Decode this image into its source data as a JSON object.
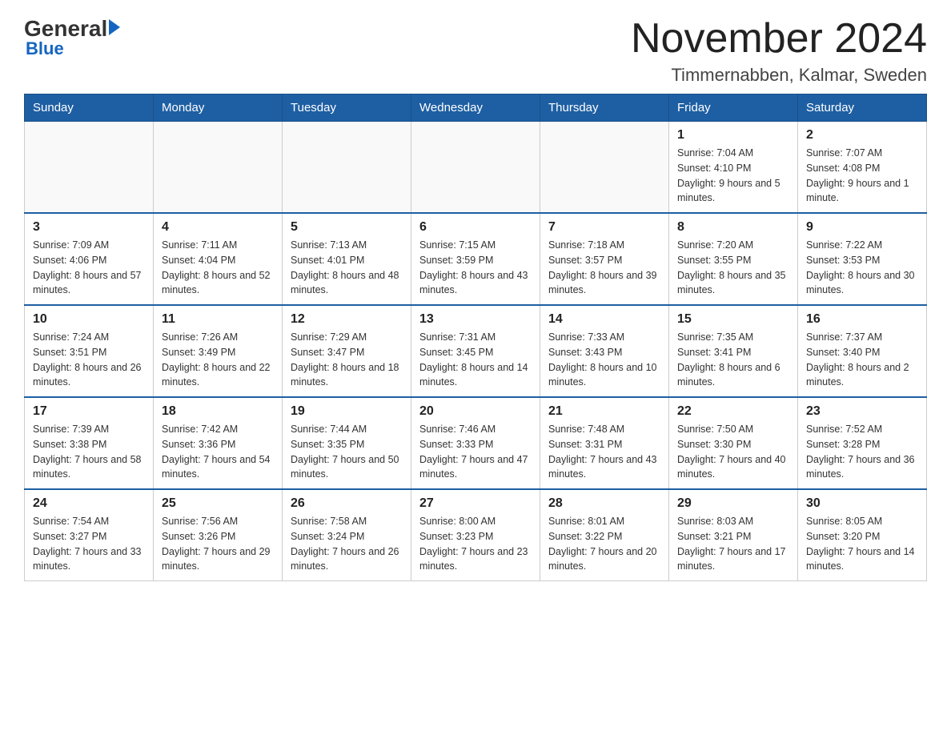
{
  "header": {
    "logo_general": "General",
    "logo_blue": "Blue",
    "month_title": "November 2024",
    "location": "Timmernabben, Kalmar, Sweden"
  },
  "days_of_week": [
    "Sunday",
    "Monday",
    "Tuesday",
    "Wednesday",
    "Thursday",
    "Friday",
    "Saturday"
  ],
  "weeks": [
    [
      {
        "day": "",
        "info": ""
      },
      {
        "day": "",
        "info": ""
      },
      {
        "day": "",
        "info": ""
      },
      {
        "day": "",
        "info": ""
      },
      {
        "day": "",
        "info": ""
      },
      {
        "day": "1",
        "info": "Sunrise: 7:04 AM\nSunset: 4:10 PM\nDaylight: 9 hours and 5 minutes."
      },
      {
        "day": "2",
        "info": "Sunrise: 7:07 AM\nSunset: 4:08 PM\nDaylight: 9 hours and 1 minute."
      }
    ],
    [
      {
        "day": "3",
        "info": "Sunrise: 7:09 AM\nSunset: 4:06 PM\nDaylight: 8 hours and 57 minutes."
      },
      {
        "day": "4",
        "info": "Sunrise: 7:11 AM\nSunset: 4:04 PM\nDaylight: 8 hours and 52 minutes."
      },
      {
        "day": "5",
        "info": "Sunrise: 7:13 AM\nSunset: 4:01 PM\nDaylight: 8 hours and 48 minutes."
      },
      {
        "day": "6",
        "info": "Sunrise: 7:15 AM\nSunset: 3:59 PM\nDaylight: 8 hours and 43 minutes."
      },
      {
        "day": "7",
        "info": "Sunrise: 7:18 AM\nSunset: 3:57 PM\nDaylight: 8 hours and 39 minutes."
      },
      {
        "day": "8",
        "info": "Sunrise: 7:20 AM\nSunset: 3:55 PM\nDaylight: 8 hours and 35 minutes."
      },
      {
        "day": "9",
        "info": "Sunrise: 7:22 AM\nSunset: 3:53 PM\nDaylight: 8 hours and 30 minutes."
      }
    ],
    [
      {
        "day": "10",
        "info": "Sunrise: 7:24 AM\nSunset: 3:51 PM\nDaylight: 8 hours and 26 minutes."
      },
      {
        "day": "11",
        "info": "Sunrise: 7:26 AM\nSunset: 3:49 PM\nDaylight: 8 hours and 22 minutes."
      },
      {
        "day": "12",
        "info": "Sunrise: 7:29 AM\nSunset: 3:47 PM\nDaylight: 8 hours and 18 minutes."
      },
      {
        "day": "13",
        "info": "Sunrise: 7:31 AM\nSunset: 3:45 PM\nDaylight: 8 hours and 14 minutes."
      },
      {
        "day": "14",
        "info": "Sunrise: 7:33 AM\nSunset: 3:43 PM\nDaylight: 8 hours and 10 minutes."
      },
      {
        "day": "15",
        "info": "Sunrise: 7:35 AM\nSunset: 3:41 PM\nDaylight: 8 hours and 6 minutes."
      },
      {
        "day": "16",
        "info": "Sunrise: 7:37 AM\nSunset: 3:40 PM\nDaylight: 8 hours and 2 minutes."
      }
    ],
    [
      {
        "day": "17",
        "info": "Sunrise: 7:39 AM\nSunset: 3:38 PM\nDaylight: 7 hours and 58 minutes."
      },
      {
        "day": "18",
        "info": "Sunrise: 7:42 AM\nSunset: 3:36 PM\nDaylight: 7 hours and 54 minutes."
      },
      {
        "day": "19",
        "info": "Sunrise: 7:44 AM\nSunset: 3:35 PM\nDaylight: 7 hours and 50 minutes."
      },
      {
        "day": "20",
        "info": "Sunrise: 7:46 AM\nSunset: 3:33 PM\nDaylight: 7 hours and 47 minutes."
      },
      {
        "day": "21",
        "info": "Sunrise: 7:48 AM\nSunset: 3:31 PM\nDaylight: 7 hours and 43 minutes."
      },
      {
        "day": "22",
        "info": "Sunrise: 7:50 AM\nSunset: 3:30 PM\nDaylight: 7 hours and 40 minutes."
      },
      {
        "day": "23",
        "info": "Sunrise: 7:52 AM\nSunset: 3:28 PM\nDaylight: 7 hours and 36 minutes."
      }
    ],
    [
      {
        "day": "24",
        "info": "Sunrise: 7:54 AM\nSunset: 3:27 PM\nDaylight: 7 hours and 33 minutes."
      },
      {
        "day": "25",
        "info": "Sunrise: 7:56 AM\nSunset: 3:26 PM\nDaylight: 7 hours and 29 minutes."
      },
      {
        "day": "26",
        "info": "Sunrise: 7:58 AM\nSunset: 3:24 PM\nDaylight: 7 hours and 26 minutes."
      },
      {
        "day": "27",
        "info": "Sunrise: 8:00 AM\nSunset: 3:23 PM\nDaylight: 7 hours and 23 minutes."
      },
      {
        "day": "28",
        "info": "Sunrise: 8:01 AM\nSunset: 3:22 PM\nDaylight: 7 hours and 20 minutes."
      },
      {
        "day": "29",
        "info": "Sunrise: 8:03 AM\nSunset: 3:21 PM\nDaylight: 7 hours and 17 minutes."
      },
      {
        "day": "30",
        "info": "Sunrise: 8:05 AM\nSunset: 3:20 PM\nDaylight: 7 hours and 14 minutes."
      }
    ]
  ]
}
